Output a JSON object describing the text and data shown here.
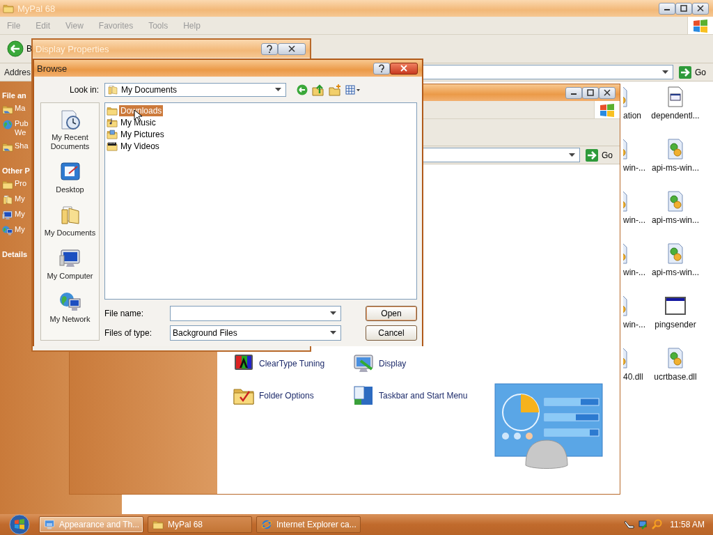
{
  "main_window": {
    "title": "MyPal 68",
    "menu": [
      "File",
      "Edit",
      "View",
      "Favorites",
      "Tools",
      "Help"
    ],
    "back_button": "B",
    "address_label": "Addres",
    "go_button": "Go",
    "task_pane": [
      {
        "title": "File an",
        "items": [
          {
            "label": "Ma",
            "kind": "shared"
          },
          {
            "label": "Pub\nWe",
            "kind": "globe"
          },
          {
            "label": "Sha",
            "kind": "shared"
          }
        ]
      },
      {
        "title": "Other P",
        "items": [
          {
            "label": "Pro",
            "kind": "folder"
          },
          {
            "label": "My",
            "kind": "docs"
          },
          {
            "label": "My",
            "kind": "computer"
          },
          {
            "label": "My",
            "kind": "network"
          }
        ]
      },
      {
        "title": "Details"
      }
    ],
    "files": [
      {
        "label": "ation",
        "kind": "dll"
      },
      {
        "label": "dependentl...",
        "kind": "page"
      },
      {
        "label": "win-...",
        "kind": "dll"
      },
      {
        "label": "api-ms-win...",
        "kind": "dll"
      },
      {
        "label": "win-...",
        "kind": "dll"
      },
      {
        "label": "api-ms-win...",
        "kind": "dll"
      },
      {
        "label": "win-...",
        "kind": "dll"
      },
      {
        "label": "api-ms-win...",
        "kind": "dll"
      },
      {
        "label": "win-...",
        "kind": "dll"
      },
      {
        "label": "pingsender",
        "kind": "app"
      },
      {
        "label": "40.dll",
        "kind": "dll"
      },
      {
        "label": "ucrtbase.dll",
        "kind": "dll"
      }
    ]
  },
  "control_panel_window": {
    "go_button": "Go",
    "tasks": [
      {
        "label": "ClearType Tuning",
        "kind": "cleartype"
      },
      {
        "label": "Display",
        "kind": "display"
      },
      {
        "label": "Folder Options",
        "kind": "folder-options"
      },
      {
        "label": "Taskbar and Start Menu",
        "kind": "taskbar"
      }
    ]
  },
  "display_properties": {
    "title": "Display Properties"
  },
  "browse_dialog": {
    "title": "Browse",
    "look_in_label": "Look in:",
    "look_in_value": "My Documents",
    "places": [
      {
        "label": "My Recent Documents",
        "kind": "recent"
      },
      {
        "label": "Desktop",
        "kind": "desktop"
      },
      {
        "label": "My Documents",
        "kind": "docs"
      },
      {
        "label": "My Computer",
        "kind": "computer"
      },
      {
        "label": "My Network",
        "kind": "network"
      }
    ],
    "files": [
      {
        "name": "Downloads",
        "kind": "folder",
        "selected": true
      },
      {
        "name": "My Music",
        "kind": "music",
        "selected": false
      },
      {
        "name": "My Pictures",
        "kind": "pictures",
        "selected": false
      },
      {
        "name": "My Videos",
        "kind": "videos",
        "selected": false
      }
    ],
    "file_name_label": "File name:",
    "file_type_label": "Files of type:",
    "file_type_value": "Background Files",
    "open_button": "Open",
    "cancel_button": "Cancel"
  },
  "taskbar": {
    "tasks": [
      {
        "label": "Appearance and Th...",
        "kind": "control-panel",
        "selected": true
      },
      {
        "label": "MyPal 68",
        "kind": "folder",
        "selected": false
      },
      {
        "label": "Internet Explorer ca...",
        "kind": "ie",
        "selected": false
      }
    ],
    "clock": "11:58 AM"
  }
}
